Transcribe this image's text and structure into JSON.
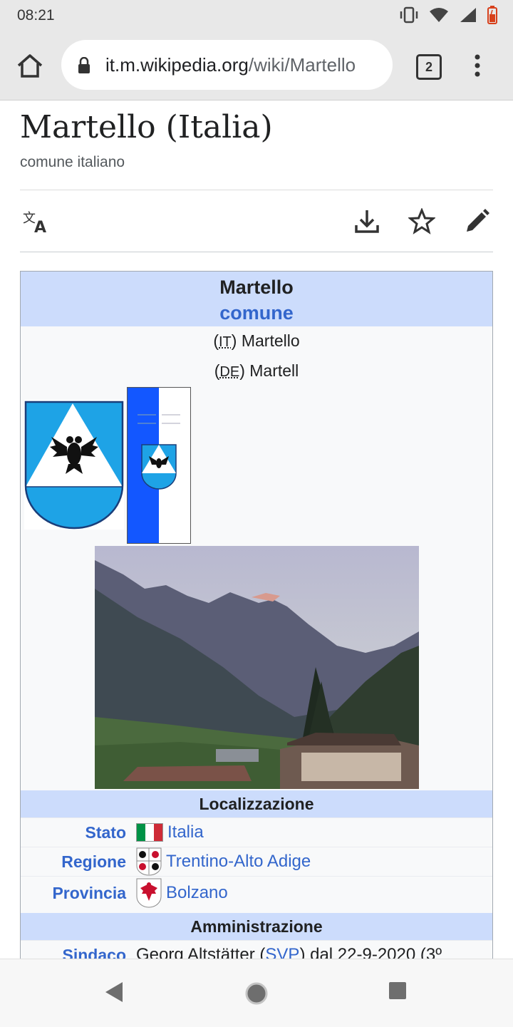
{
  "status_bar": {
    "time": "08:21"
  },
  "browser": {
    "url_domain": "it.m.wikipedia.org",
    "url_path": "/wiki/Martello",
    "tab_count": "2"
  },
  "article": {
    "title": "Martello (Italia)",
    "subtitle": "comune italiano"
  },
  "infobox": {
    "name": "Martello",
    "type": "comune",
    "names": [
      {
        "lang": "IT",
        "name": "Martello"
      },
      {
        "lang": "DE",
        "name": "Martell"
      }
    ],
    "section_location": "Localizzazione",
    "rows": [
      {
        "label": "Stato",
        "value": "Italia"
      },
      {
        "label": "Regione",
        "value": "Trentino-Alto Adige"
      },
      {
        "label": "Provincia",
        "value": "Bolzano"
      }
    ],
    "section_admin": "Amministrazione",
    "mayor_label": "Sindaco",
    "mayor_name": "Georg Altstätter (",
    "mayor_party": "SVP",
    "mayor_rest": ") dal 22-9-2020 (3º"
  },
  "colors": {
    "link": "#3366cc",
    "infobox_header": "#ccdcfc",
    "chrome_bar": "#e8e8e8"
  }
}
